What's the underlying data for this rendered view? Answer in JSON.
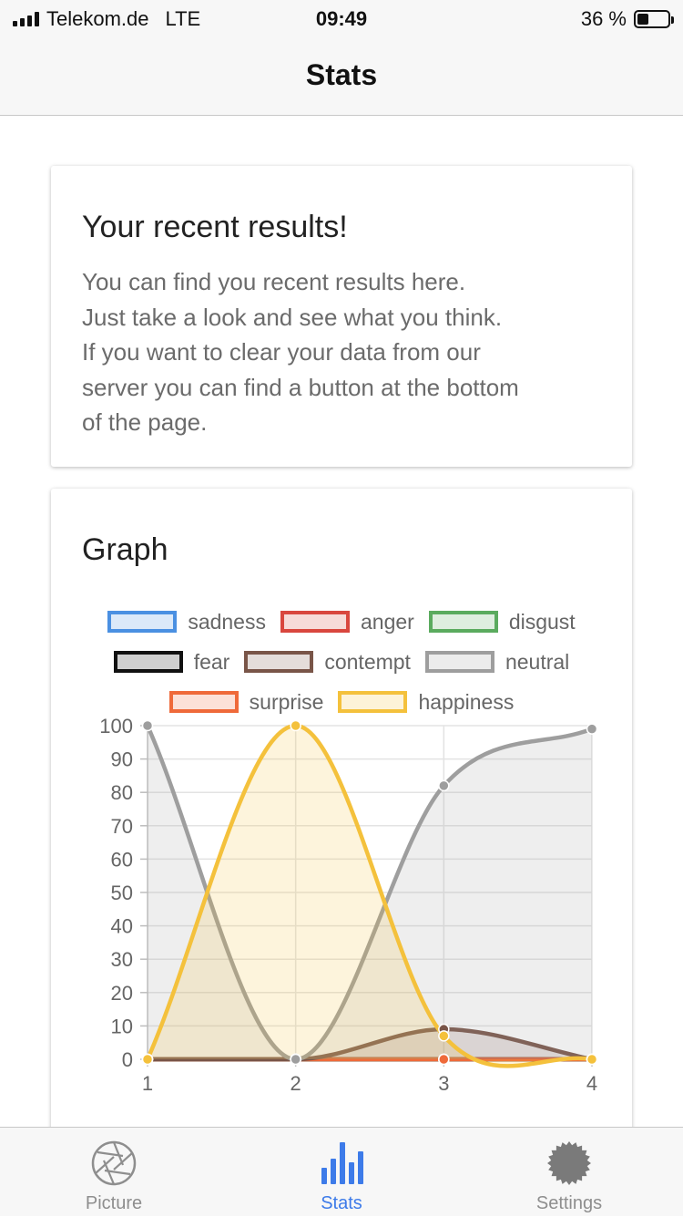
{
  "status_bar": {
    "carrier": "Telekom.de",
    "network": "LTE",
    "time": "09:49",
    "battery_text": "36 %",
    "battery_level": 0.36
  },
  "nav": {
    "title": "Stats"
  },
  "intro_card": {
    "title": "Your recent results!",
    "lines": [
      "You can find you recent results here.",
      "Just take a look and see what you think.",
      "If you want to clear your data from our",
      "server you can find a button at the bottom",
      "of the page."
    ]
  },
  "graph_card": {
    "title": "Graph"
  },
  "colors": {
    "sadness": "#4a90e2",
    "anger": "#d9463e",
    "disgust": "#5aab5e",
    "fear": "#111111",
    "contempt": "#795548",
    "neutral": "#9e9e9e",
    "surprise": "#ef6a3a",
    "happiness": "#f4c13c",
    "accent": "#3d7be9"
  },
  "chart_data": {
    "type": "line",
    "x": [
      1,
      2,
      3,
      4
    ],
    "xlim": [
      1,
      4
    ],
    "ylim": [
      0,
      100
    ],
    "y_ticks": [
      0,
      10,
      20,
      30,
      40,
      50,
      60,
      70,
      80,
      90,
      100
    ],
    "x_ticks": [
      1,
      2,
      3,
      4
    ],
    "grid": true,
    "legend_position": "top",
    "series": [
      {
        "name": "sadness",
        "values": [
          0,
          0,
          0,
          0
        ]
      },
      {
        "name": "anger",
        "values": [
          0,
          0,
          0,
          0
        ]
      },
      {
        "name": "disgust",
        "values": [
          0,
          0,
          0,
          0
        ]
      },
      {
        "name": "fear",
        "values": [
          0,
          0,
          0,
          0
        ]
      },
      {
        "name": "contempt",
        "values": [
          0,
          0,
          9,
          0
        ]
      },
      {
        "name": "neutral",
        "values": [
          100,
          0,
          82,
          99
        ]
      },
      {
        "name": "surprise",
        "values": [
          0,
          0,
          0,
          0
        ]
      },
      {
        "name": "happiness",
        "values": [
          0,
          100,
          7,
          0
        ]
      }
    ]
  },
  "tabs": [
    {
      "label": "Picture",
      "icon": "aperture-icon",
      "active": false
    },
    {
      "label": "Stats",
      "icon": "bar-chart-icon",
      "active": true
    },
    {
      "label": "Settings",
      "icon": "gear-icon",
      "active": false
    }
  ]
}
